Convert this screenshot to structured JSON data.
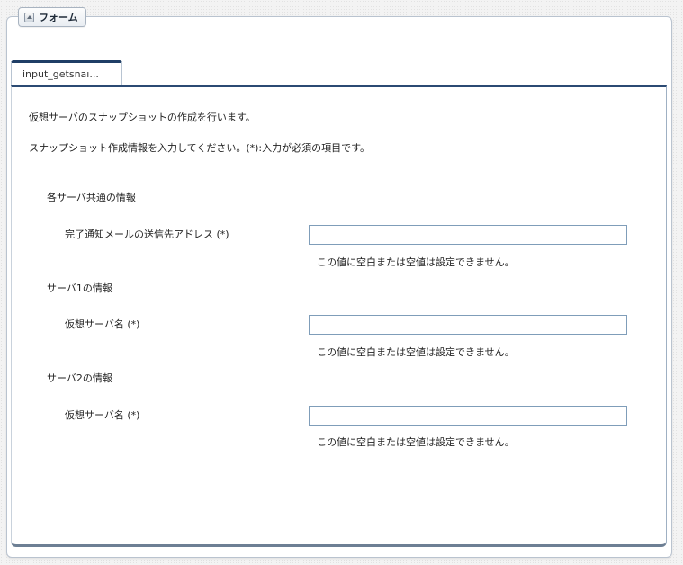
{
  "form": {
    "title": "フォーム",
    "tab_label": "input_getsnaı...",
    "description": "仮想サーバのスナップショットの作成を行います。",
    "instruction": "スナップショット作成情報を入力してください。(*):入力が必須の項目です。"
  },
  "sections": [
    {
      "heading": "各サーバ共通の情報",
      "field_label": "完了通知メールの送信先アドレス (*)",
      "field_value": "",
      "validation": "この値に空白または空値は設定できません。"
    },
    {
      "heading": "サーバ1の情報",
      "field_label": "仮想サーバ名 (*)",
      "field_value": "",
      "validation": "この値に空白または空値は設定できません。"
    },
    {
      "heading": "サーバ2の情報",
      "field_label": "仮想サーバ名 (*)",
      "field_value": "",
      "validation": "この値に空白または空値は設定できません。"
    }
  ]
}
